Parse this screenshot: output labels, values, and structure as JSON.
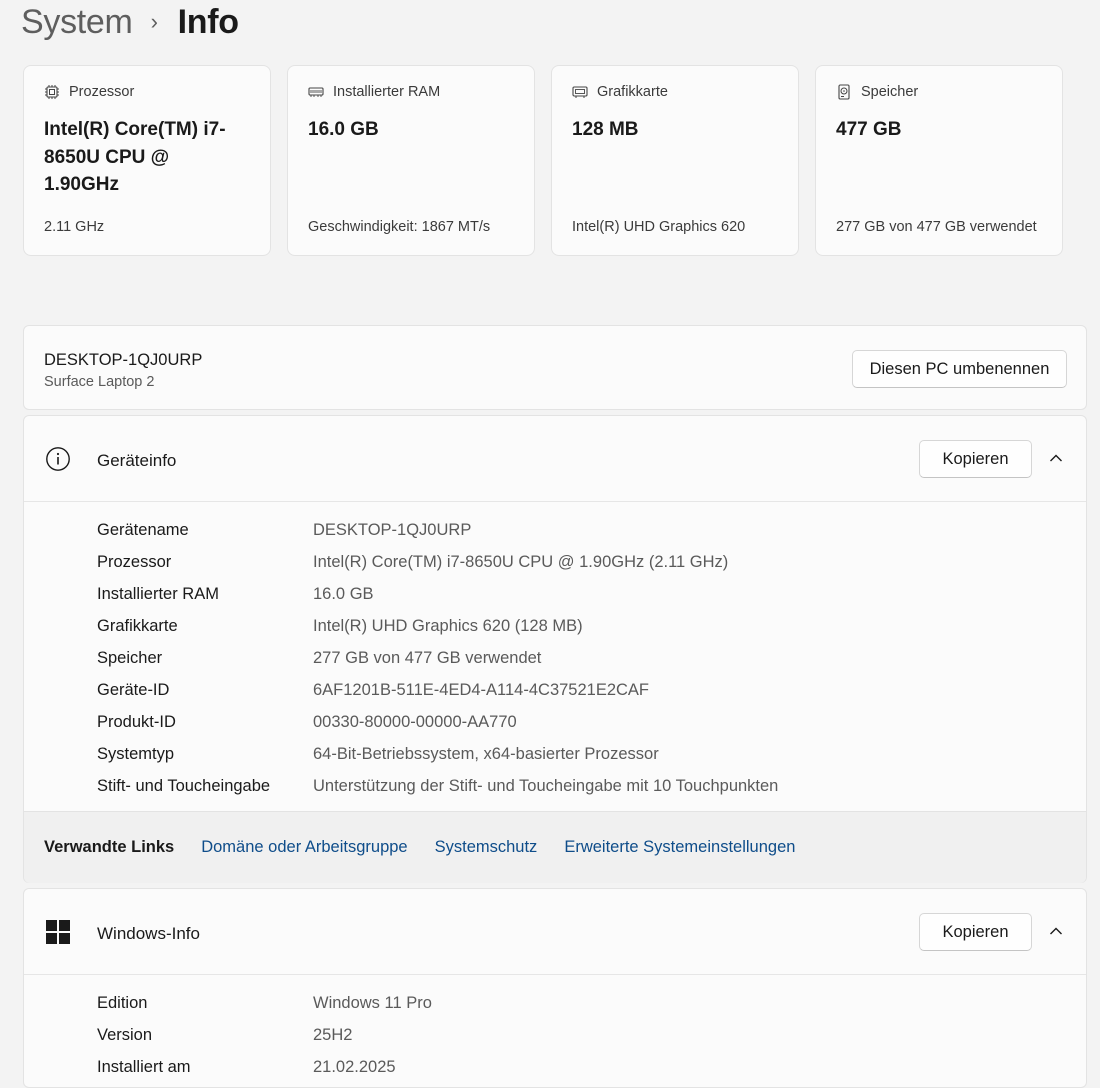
{
  "breadcrumb": {
    "parent": "System",
    "separator": "›",
    "current": "Info"
  },
  "spec_cards": [
    {
      "icon": "processor-icon",
      "title": "Prozessor",
      "value": "Intel(R) Core(TM) i7-8650U CPU @ 1.90GHz",
      "sub": "2.11 GHz"
    },
    {
      "icon": "ram-icon",
      "title": "Installierter RAM",
      "value": "16.0 GB",
      "sub": "Geschwindigkeit: 1867 MT/s"
    },
    {
      "icon": "gpu-icon",
      "title": "Grafikkarte",
      "value": "128 MB",
      "sub": "Intel(R) UHD Graphics 620"
    },
    {
      "icon": "storage-icon",
      "title": "Speicher",
      "value": "477 GB",
      "sub": "277 GB von 477 GB verwendet"
    }
  ],
  "device": {
    "name": "DESKTOP-1QJ0URP",
    "model": "Surface Laptop 2",
    "rename_label": "Diesen PC umbenennen"
  },
  "device_info": {
    "icon": "info-icon",
    "title": "Geräteinfo",
    "copy_label": "Kopieren",
    "rows": [
      {
        "key": "Gerätename",
        "value": "DESKTOP-1QJ0URP"
      },
      {
        "key": "Prozessor",
        "value": "Intel(R) Core(TM) i7-8650U CPU @ 1.90GHz (2.11 GHz)"
      },
      {
        "key": "Installierter RAM",
        "value": "16.0 GB"
      },
      {
        "key": "Grafikkarte",
        "value": "Intel(R) UHD Graphics 620 (128 MB)"
      },
      {
        "key": "Speicher",
        "value": "277 GB von 477 GB verwendet"
      },
      {
        "key": "Geräte-ID",
        "value": "6AF1201B-511E-4ED4-A114-4C37521E2CAF"
      },
      {
        "key": "Produkt-ID",
        "value": "00330-80000-00000-AA770"
      },
      {
        "key": "Systemtyp",
        "value": "64-Bit-Betriebssystem, x64-basierter Prozessor"
      },
      {
        "key": "Stift- und Toucheingabe",
        "value": "Unterstützung der Stift- und Toucheingabe mit 10 Touchpunkten"
      }
    ],
    "related_links": {
      "title": "Verwandte Links",
      "links": [
        "Domäne oder Arbeitsgruppe",
        "Systemschutz",
        "Erweiterte Systemeinstellungen"
      ]
    }
  },
  "windows_info": {
    "icon": "windows-logo-icon",
    "title": "Windows-Info",
    "copy_label": "Kopieren",
    "rows": [
      {
        "key": "Edition",
        "value": "Windows 11 Pro"
      },
      {
        "key": "Version",
        "value": "25H2"
      },
      {
        "key": "Installiert am",
        "value": "21.02.2025"
      }
    ]
  },
  "colors": {
    "link": "#0f4d8a",
    "panel": "#fbfbfb",
    "background": "#f3f3f3"
  }
}
